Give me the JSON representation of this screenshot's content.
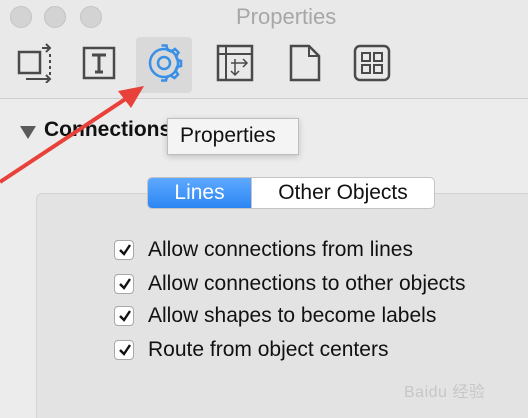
{
  "window": {
    "title": "Properties"
  },
  "toolbar": {
    "tools": [
      {
        "icon": "geometry-icon",
        "name": "geometry"
      },
      {
        "icon": "text-icon",
        "name": "text"
      },
      {
        "icon": "gear-icon",
        "name": "properties",
        "selected": true
      },
      {
        "icon": "canvas-size-icon",
        "name": "canvas"
      },
      {
        "icon": "document-icon",
        "name": "document"
      },
      {
        "icon": "grid-icon",
        "name": "grid"
      }
    ]
  },
  "tooltip": {
    "text": "Properties"
  },
  "section": {
    "title": "Connections"
  },
  "segmented": {
    "options": [
      "Lines",
      "Other Objects"
    ],
    "selected": "Lines"
  },
  "checkboxes": [
    {
      "label": "Allow connections from lines",
      "checked": true
    },
    {
      "label": "Allow connections to other objects",
      "checked": true
    },
    {
      "label": "Allow shapes to become labels",
      "checked": true
    },
    {
      "label": "Route from object centers",
      "checked": true
    }
  ],
  "watermark": {
    "text": "Baidu 经验"
  },
  "colors": {
    "accent": "#2c86f3",
    "annotation_arrow": "#e8413a",
    "icon_selected": "#3a8fe6"
  }
}
